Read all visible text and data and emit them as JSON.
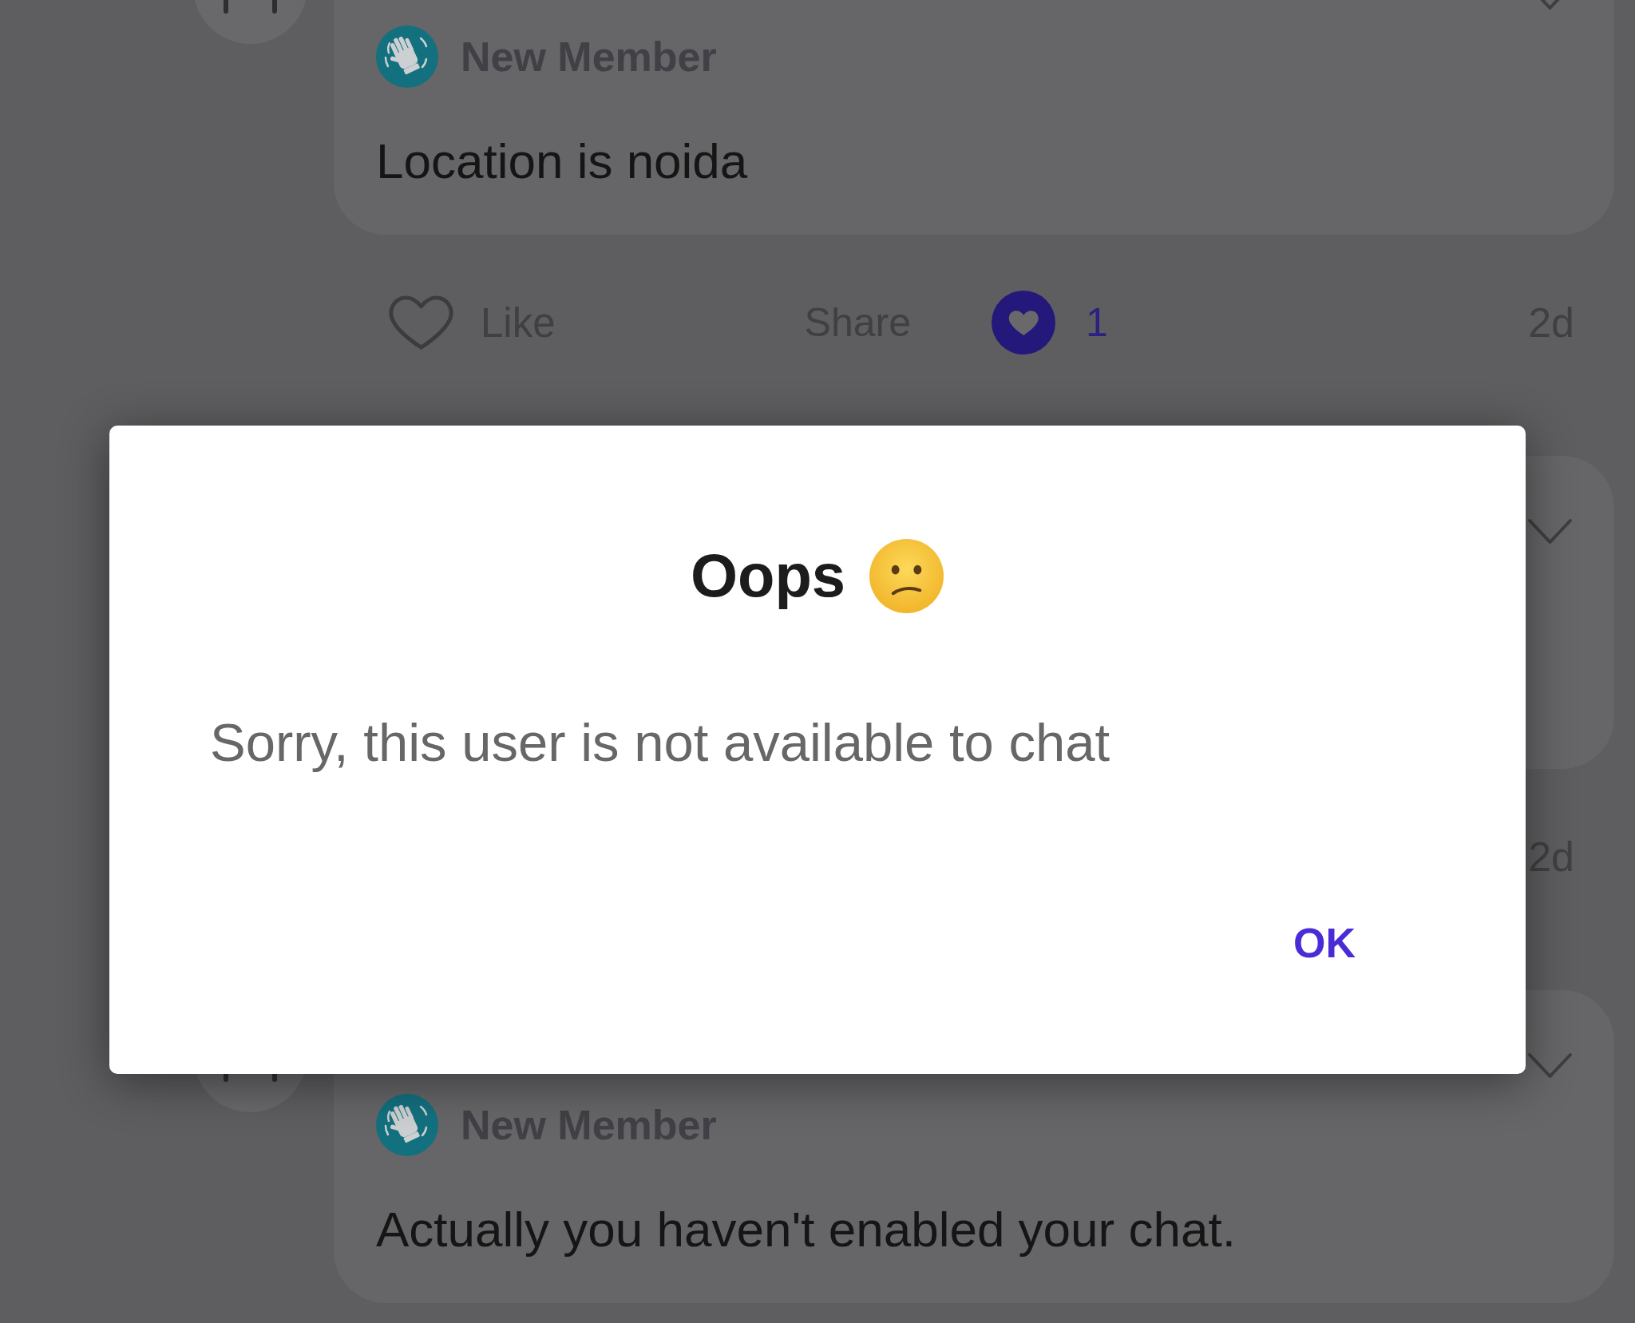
{
  "feed": {
    "posts": [
      {
        "author_badge": "New Member",
        "body": "Location is noida",
        "footer": {
          "liked": false,
          "like_label": "Like",
          "share_label": "Share",
          "reaction_count": "1",
          "time": "2d"
        }
      },
      {
        "footer": {
          "time": "2d"
        }
      },
      {
        "author_badge": "New Member",
        "body": "Actually you haven't enabled your chat."
      }
    ]
  },
  "dialog": {
    "title": "Oops",
    "message": "Sorry, this user is not available to chat",
    "buttons": [
      "OK"
    ]
  }
}
